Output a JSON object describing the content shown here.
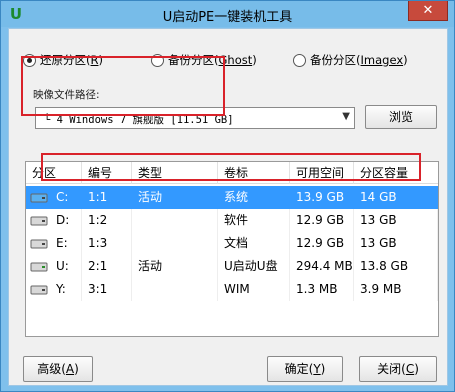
{
  "window": {
    "title": "U启动PE一键装机工具",
    "logo_glyph": "U",
    "close_label": "✕"
  },
  "options": [
    {
      "label": "还原分区",
      "key": "R",
      "selected": true
    },
    {
      "label": "备份分区",
      "key": "Ghost",
      "selected": false
    },
    {
      "label": "备份分区",
      "key": "Imagex",
      "selected": false
    }
  ],
  "image_path": {
    "label": "映像文件路径:",
    "value": "└ 4 Windows 7 旗舰版 [11.51 GB]",
    "browse_label": "浏览"
  },
  "table": {
    "columns": [
      "分区",
      "编号",
      "类型",
      "卷标",
      "可用空间",
      "分区容量"
    ],
    "rows": [
      {
        "drive": "C:",
        "num": "1:1",
        "type": "活动",
        "label": "系统",
        "free": "13.9 GB",
        "size": "14 GB",
        "selected": true,
        "icon": "hdd-system-icon"
      },
      {
        "drive": "D:",
        "num": "1:2",
        "type": "",
        "label": "软件",
        "free": "12.9 GB",
        "size": "13 GB",
        "selected": false,
        "icon": "hdd-icon"
      },
      {
        "drive": "E:",
        "num": "1:3",
        "type": "",
        "label": "文档",
        "free": "12.9 GB",
        "size": "13 GB",
        "selected": false,
        "icon": "hdd-icon"
      },
      {
        "drive": "U:",
        "num": "2:1",
        "type": "活动",
        "label": "U启动U盘",
        "free": "294.4 MB",
        "size": "13.8 GB",
        "selected": false,
        "icon": "usb-drive-icon"
      },
      {
        "drive": "Y:",
        "num": "3:1",
        "type": "",
        "label": "WIM",
        "free": "1.3 MB",
        "size": "3.9 MB",
        "selected": false,
        "icon": "hdd-icon"
      }
    ]
  },
  "buttons": {
    "advanced": {
      "label": "高级",
      "key": "A"
    },
    "ok": {
      "label": "确定",
      "key": "Y"
    },
    "close": {
      "label": "关闭",
      "key": "C"
    }
  },
  "colors": {
    "selection": "#3399ff",
    "highlight_frame": "#d9222a",
    "titlebar": "#77bce9"
  }
}
